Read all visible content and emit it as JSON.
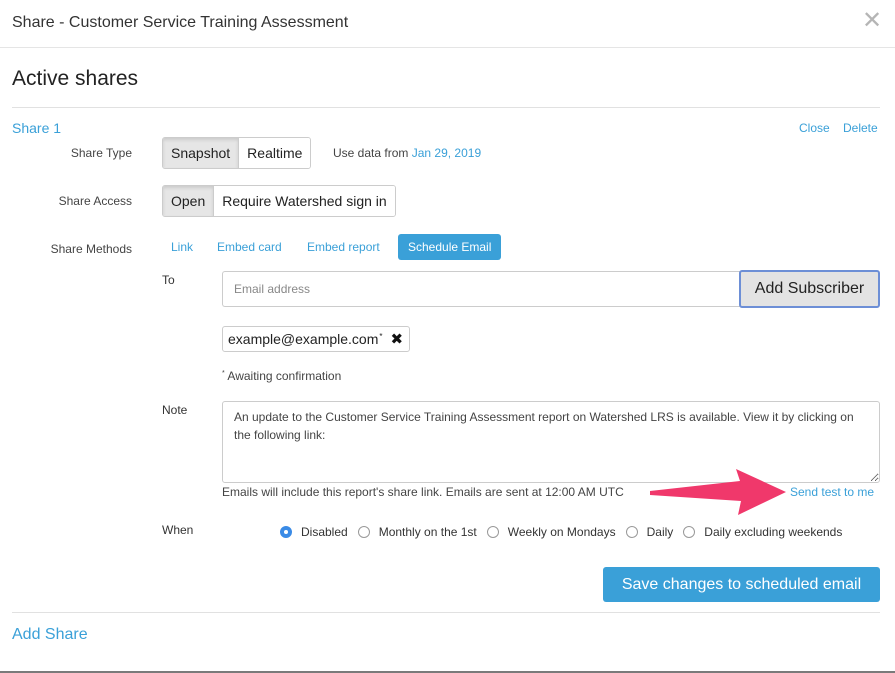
{
  "modal": {
    "title": "Share - Customer Service Training Assessment",
    "close_glyph": "✕"
  },
  "section_title": "Active shares",
  "share": {
    "name": "Share 1",
    "close_label": "Close",
    "delete_label": "Delete",
    "share_type": {
      "label": "Share Type",
      "options": [
        "Snapshot",
        "Realtime"
      ],
      "selected": "Snapshot",
      "use_data_prefix": "Use data from",
      "use_data_date": "Jan 29, 2019"
    },
    "share_access": {
      "label": "Share Access",
      "options": [
        "Open",
        "Require Watershed sign in"
      ],
      "selected": "Open"
    },
    "share_methods": {
      "label": "Share Methods",
      "tabs": [
        "Link",
        "Embed card",
        "Embed report",
        "Schedule Email"
      ],
      "active": "Schedule Email"
    },
    "email": {
      "to_label": "To",
      "placeholder": "Email address",
      "add_button": "Add Subscriber",
      "subscriber": "example@example.com",
      "subscriber_marker": "*",
      "remove_glyph": "✖",
      "awaiting_marker": "*",
      "awaiting_text": " Awaiting confirmation",
      "note_label": "Note",
      "note_text": "An update to the Customer Service Training Assessment report on Watershed LRS is available. View it by clicking on the following link:",
      "note_help": "Emails will include this report's share link. Emails are sent at 12:00 AM UTC",
      "send_test": "Send test to me",
      "when_label": "When",
      "schedule_options": [
        "Disabled",
        "Monthly on the 1st",
        "Weekly on Mondays",
        "Daily",
        "Daily excluding weekends"
      ],
      "schedule_selected": "Disabled",
      "save_button": "Save changes to scheduled email"
    }
  },
  "add_share": "Add Share",
  "colors": {
    "accent": "#3aa0d8",
    "arrow": "#f0386b",
    "radio_checked": "#3a8be6"
  }
}
